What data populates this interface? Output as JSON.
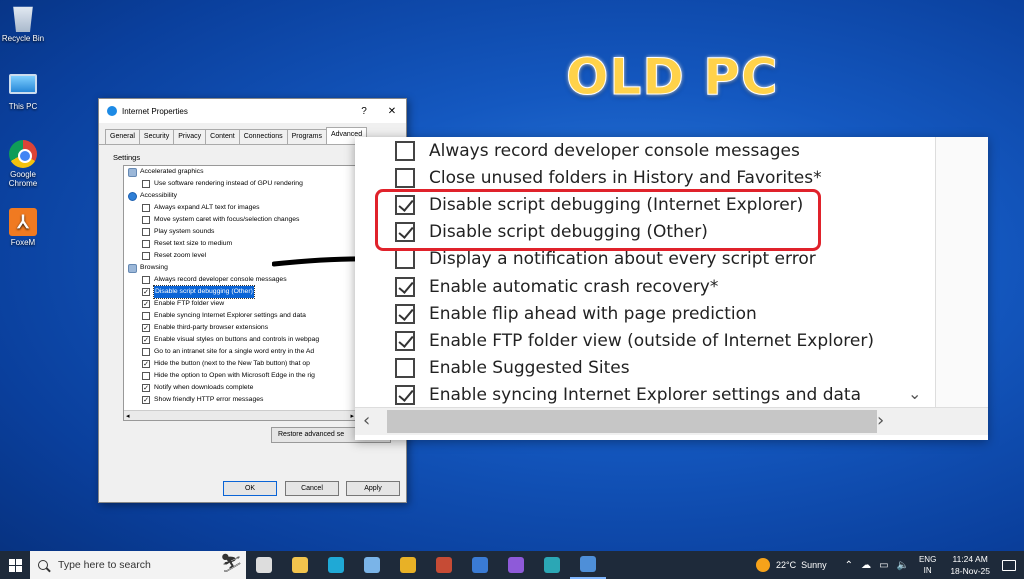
{
  "desktop": {
    "icons": [
      {
        "label": "Recycle Bin"
      },
      {
        "label": "This PC"
      },
      {
        "label": "Google Chrome"
      },
      {
        "label": "FoxeM"
      }
    ],
    "headline": "OLD PC"
  },
  "dialog": {
    "title": "Internet Properties",
    "help": "?",
    "close": "✕",
    "tabs": [
      "General",
      "Security",
      "Privacy",
      "Content",
      "Connections",
      "Programs",
      "Advanced"
    ],
    "active_tab": "Advanced",
    "settings_label": "Settings",
    "rows": [
      {
        "type": "cat",
        "icon": "monitor-icon",
        "label": "Accelerated graphics"
      },
      {
        "type": "item",
        "checked": false,
        "label": "Use software rendering instead of GPU rendering"
      },
      {
        "type": "cat",
        "icon": "accessibility-icon",
        "label": "Accessibility"
      },
      {
        "type": "item",
        "checked": false,
        "label": "Always expand ALT text for images"
      },
      {
        "type": "item",
        "checked": false,
        "label": "Move system caret with focus/selection changes"
      },
      {
        "type": "item",
        "checked": false,
        "label": "Play system sounds"
      },
      {
        "type": "item",
        "checked": false,
        "label": "Reset text size to medium"
      },
      {
        "type": "item",
        "checked": false,
        "label": "Reset zoom level"
      },
      {
        "type": "cat",
        "icon": "browsing-icon",
        "label": "Browsing"
      },
      {
        "type": "item",
        "checked": false,
        "label": "Always record developer console messages"
      },
      {
        "type": "item",
        "checked": true,
        "selected": true,
        "label": "Disable script debugging (Other)"
      },
      {
        "type": "item",
        "checked": true,
        "label": "Enable FTP folder view"
      },
      {
        "type": "item",
        "checked": false,
        "label": "Enable syncing Internet Explorer settings and data"
      },
      {
        "type": "item",
        "checked": true,
        "label": "Enable third-party browser extensions"
      },
      {
        "type": "item",
        "checked": true,
        "label": "Enable visual styles on buttons and controls in webpag"
      },
      {
        "type": "item",
        "checked": false,
        "label": "Go to an intranet site for a single word entry in the Ad"
      },
      {
        "type": "item",
        "checked": true,
        "label": "Hide the button (next to the New Tab button) that op"
      },
      {
        "type": "item",
        "checked": false,
        "label": "Hide the option to Open with Microsoft Edge in the rig"
      },
      {
        "type": "item",
        "checked": true,
        "label": "Notify when downloads complete"
      },
      {
        "type": "item",
        "checked": true,
        "label": "Show friendly HTTP error messages"
      }
    ],
    "restore_button": "Restore advanced se",
    "ok": "OK",
    "cancel": "Cancel",
    "apply": "Apply"
  },
  "zoom_panel": {
    "rows": [
      {
        "checked": false,
        "label": "Always record developer console messages"
      },
      {
        "checked": false,
        "label": "Close unused folders in History and Favorites*"
      },
      {
        "checked": true,
        "label": "Disable script debugging (Internet Explorer)"
      },
      {
        "checked": true,
        "label": "Disable script debugging (Other)"
      },
      {
        "checked": false,
        "label": "Display a notification about every script error"
      },
      {
        "checked": true,
        "label": "Enable automatic crash recovery*"
      },
      {
        "checked": true,
        "label": "Enable flip ahead with page prediction"
      },
      {
        "checked": true,
        "label": "Enable FTP folder view (outside of Internet Explorer)"
      },
      {
        "checked": false,
        "label": "Enable Suggested Sites"
      },
      {
        "checked": true,
        "label": "Enable syncing Internet Explorer settings and data"
      }
    ],
    "highlight_color": "#e0222b"
  },
  "taskbar": {
    "search_placeholder": "Type here to search",
    "apps": [
      {
        "icon": "task-view-icon",
        "color": "#dddddd"
      },
      {
        "icon": "file-explorer-icon",
        "color": "#f2c44d"
      },
      {
        "icon": "edge-icon",
        "color": "#1fa9d6"
      },
      {
        "icon": "notepad-icon",
        "color": "#7ab4e8"
      },
      {
        "icon": "chrome-icon",
        "color": "#e8b126"
      },
      {
        "icon": "games-icon",
        "color": "#c64b35"
      },
      {
        "icon": "downloader-icon",
        "color": "#3a7bd5"
      },
      {
        "icon": "clapper-icon",
        "color": "#8e5ad9"
      },
      {
        "icon": "edge-dev-icon",
        "color": "#2ba7b5"
      },
      {
        "icon": "control-panel-icon",
        "color": "#4e8fd8"
      }
    ],
    "weather_temp": "22°C",
    "weather_text": "Sunny",
    "lang_top": "ENG",
    "lang_bottom": "IN",
    "time": "11:24 AM",
    "date": "18-Nov-25"
  }
}
